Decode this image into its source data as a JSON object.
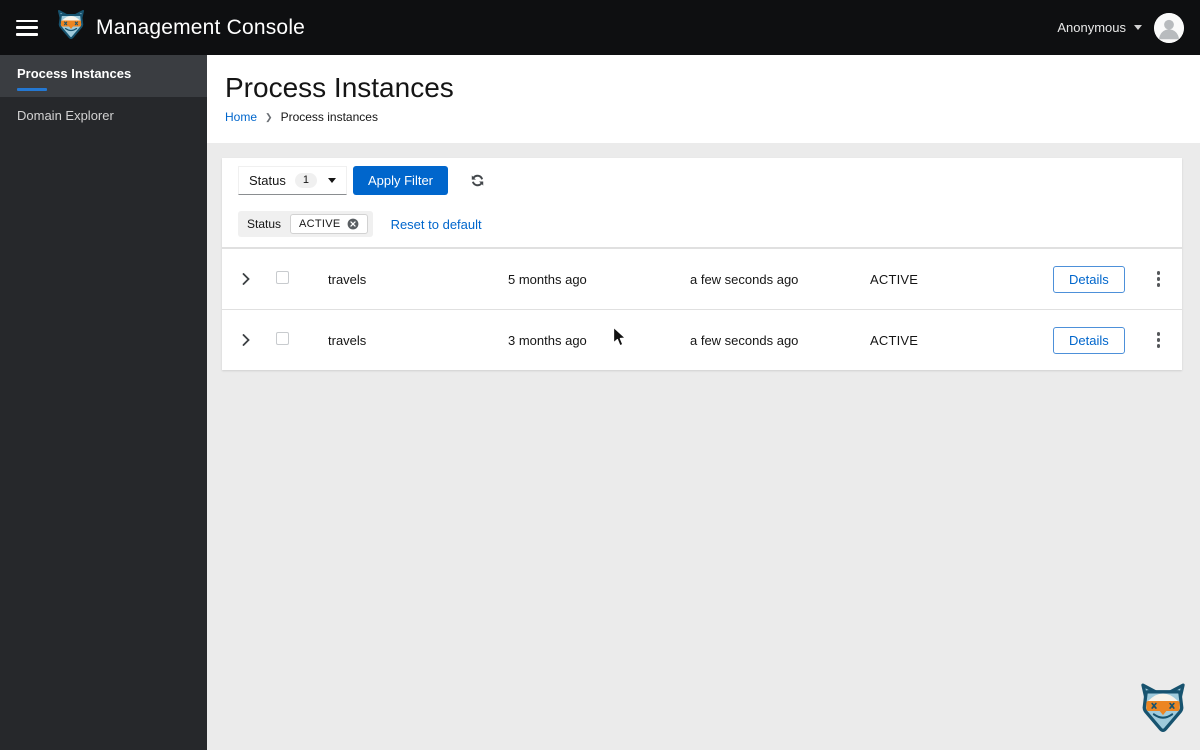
{
  "masthead": {
    "title": "Management Console",
    "user": "Anonymous"
  },
  "sidebar": {
    "items": [
      {
        "label": "Process Instances",
        "active": true
      },
      {
        "label": "Domain Explorer",
        "active": false
      }
    ]
  },
  "page": {
    "title": "Process Instances",
    "breadcrumb": [
      {
        "label": "Home",
        "link": true
      },
      {
        "label": "Process instances",
        "link": false
      }
    ]
  },
  "toolbar": {
    "filter_label": "Status",
    "filter_count": "1",
    "apply_label": "Apply Filter",
    "chip_category": "Status",
    "chips": [
      "ACTIVE"
    ],
    "reset_label": "Reset to default"
  },
  "table": {
    "rows": [
      {
        "name": "travels",
        "started": "5 months ago",
        "updated": "a few seconds ago",
        "state": "ACTIVE",
        "details_label": "Details"
      },
      {
        "name": "travels",
        "started": "3 months ago",
        "updated": "a few seconds ago",
        "state": "ACTIVE",
        "details_label": "Details"
      }
    ]
  },
  "icons": {
    "hamburger": "hamburger-icon",
    "brand": "kogito-logo-icon",
    "user_caret": "chevron-down-icon",
    "avatar": "user-avatar-icon",
    "select_caret": "chevron-down-icon",
    "refresh": "sync-icon",
    "chip_close": "times-circle-icon",
    "row_expand": "angle-right-icon",
    "row_actions": "kebab-icon",
    "pointer": "mouse-cursor"
  },
  "colors": {
    "primary_blue": "#0066cc",
    "nav_accent_blue": "#2478d2",
    "masthead_bg": "#0e0f11",
    "sidebar_bg": "#26282b",
    "content_bg": "#ebebeb",
    "text": "#151515",
    "logo_orange": "#ec8522",
    "logo_navy": "#17536f",
    "logo_lightblue": "#9fcbdc"
  }
}
